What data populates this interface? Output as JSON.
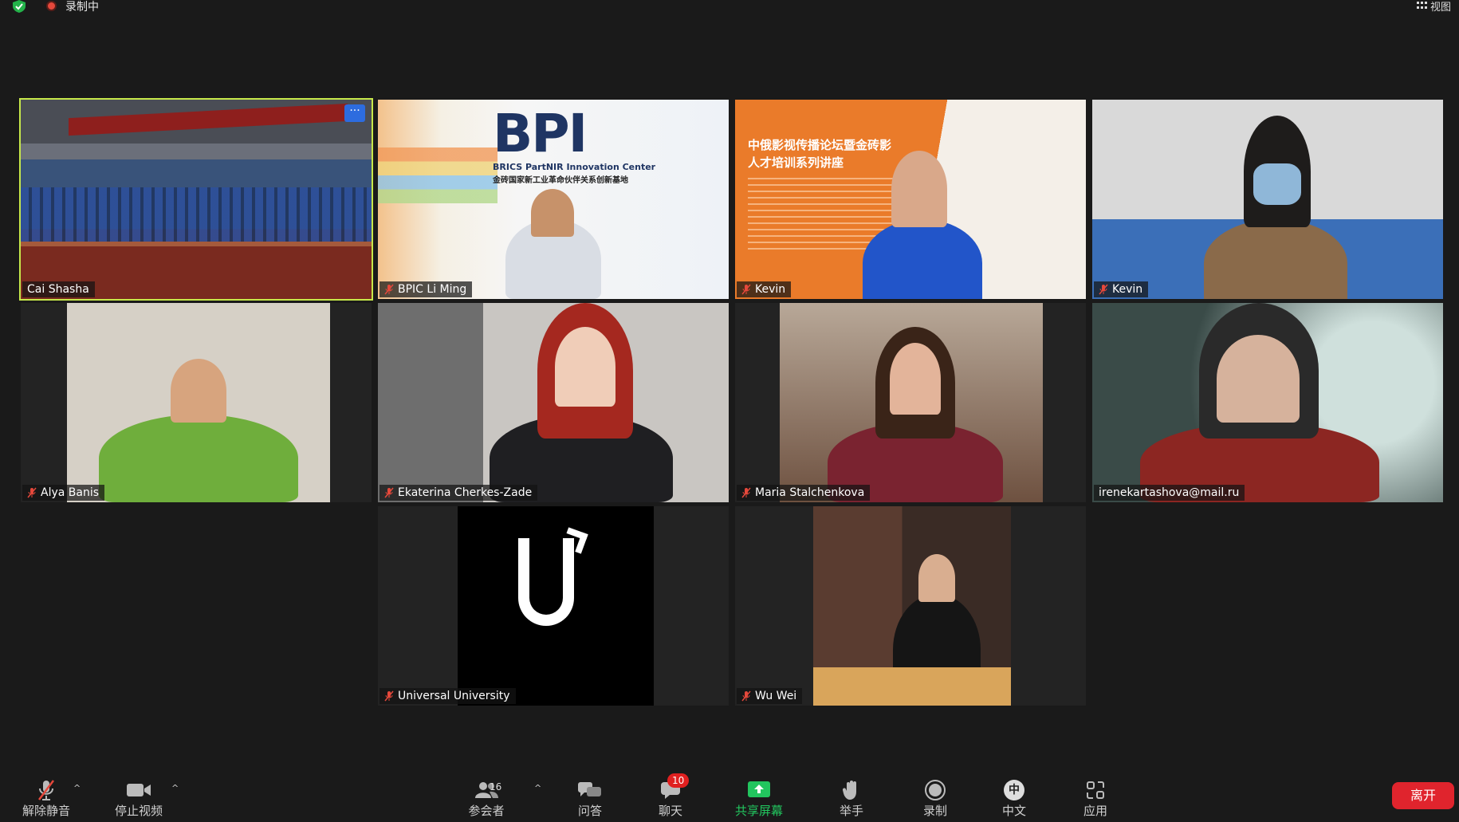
{
  "topbar": {
    "recording_label": "录制中",
    "view_label": "视图"
  },
  "participants": [
    {
      "name": "Cai Shasha",
      "muted": false,
      "active": true
    },
    {
      "name": "BPIC Li Ming",
      "muted": true
    },
    {
      "name": "Kevin",
      "muted": true
    },
    {
      "name": "Kevin",
      "muted": true
    },
    {
      "name": "Alya Banis",
      "muted": true
    },
    {
      "name": "Ekaterina Cherkes-Zade",
      "muted": true
    },
    {
      "name": "Maria Stalchenkova",
      "muted": true
    },
    {
      "name": "irenekartashova@mail.ru",
      "muted": false
    },
    {
      "name": "Universal University",
      "muted": true
    },
    {
      "name": "Wu Wei",
      "muted": true
    }
  ],
  "feeds": {
    "bpi_logo": "BPI",
    "bpi_sub1": "BRICS PartNIR Innovation Center",
    "bpi_sub2": "金砖国家新工业革命伙伴关系创新基地",
    "poster_line1": "中俄影视传播论坛暨金砖影",
    "poster_line2": "人才培训系列讲座"
  },
  "toolbar": {
    "unmute": "解除静音",
    "stop_video": "停止视频",
    "participants": "参会者",
    "participants_count": "16",
    "qa": "问答",
    "chat": "聊天",
    "chat_badge": "10",
    "share": "共享屏幕",
    "raise_hand": "举手",
    "record": "录制",
    "language": "中文",
    "language_icon": "中",
    "apps": "应用",
    "leave": "离开"
  },
  "colors": {
    "active_outline": "#c7e84a",
    "share_green": "#22c55e",
    "leave_red": "#e0242d",
    "badge_red": "#e02020"
  }
}
